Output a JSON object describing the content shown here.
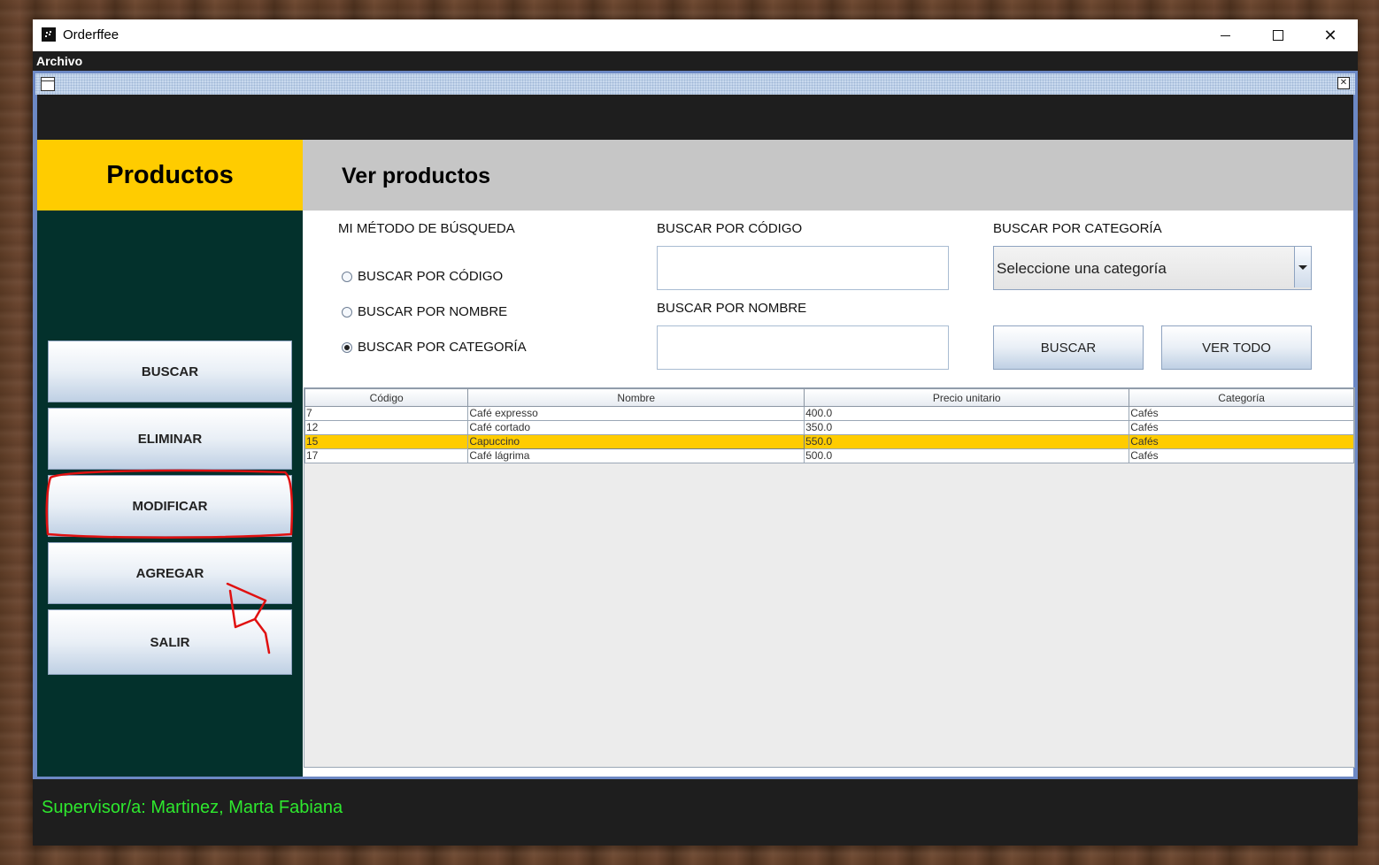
{
  "window": {
    "title": "Orderffee",
    "minimize": "",
    "maximize": "",
    "close": "✕"
  },
  "menu": {
    "archivo": "Archivo"
  },
  "sidebar": {
    "title": "Productos",
    "buttons": {
      "buscar": "BUSCAR",
      "eliminar": "ELIMINAR",
      "modificar": "MODIFICAR",
      "agregar": "AGREGAR",
      "salir": "SALIR"
    }
  },
  "main": {
    "title": "Ver productos",
    "search_method": {
      "label": "MI MÉTODO DE BÚSQUEDA",
      "options": [
        "BUSCAR POR CÓDIGO",
        "BUSCAR POR NOMBRE",
        "BUSCAR POR CATEGORÍA"
      ],
      "selected": "BUSCAR POR CATEGORÍA"
    },
    "by_code": {
      "label": "BUSCAR POR CÓDIGO",
      "value": ""
    },
    "by_name": {
      "label": "BUSCAR POR NOMBRE",
      "value": ""
    },
    "by_category": {
      "label": "BUSCAR POR CATEGORÍA",
      "selected": "Seleccione una categoría"
    },
    "buscar_button": "BUSCAR",
    "ver_todo_button": "VER TODO"
  },
  "table": {
    "columns": [
      "Código",
      "Nombre",
      "Precio unitario",
      "Categoría"
    ],
    "rows": [
      [
        "7",
        "Café expresso",
        "400.0",
        "Cafés"
      ],
      [
        "12",
        "Café cortado",
        "350.0",
        "Cafés"
      ],
      [
        "15",
        "Capuccino",
        "550.0",
        "Cafés"
      ],
      [
        "17",
        "Café lágrima",
        "500.0",
        "Cafés"
      ]
    ],
    "selected_row": 2
  },
  "status": {
    "supervisor": "Supervisor/a: Martinez, Marta Fabiana"
  },
  "colors": {
    "accent_yellow": "#ffcc00",
    "sidebar_bg": "#03312c",
    "status_text": "#2ee82e",
    "annotation_red": "#e01010"
  }
}
